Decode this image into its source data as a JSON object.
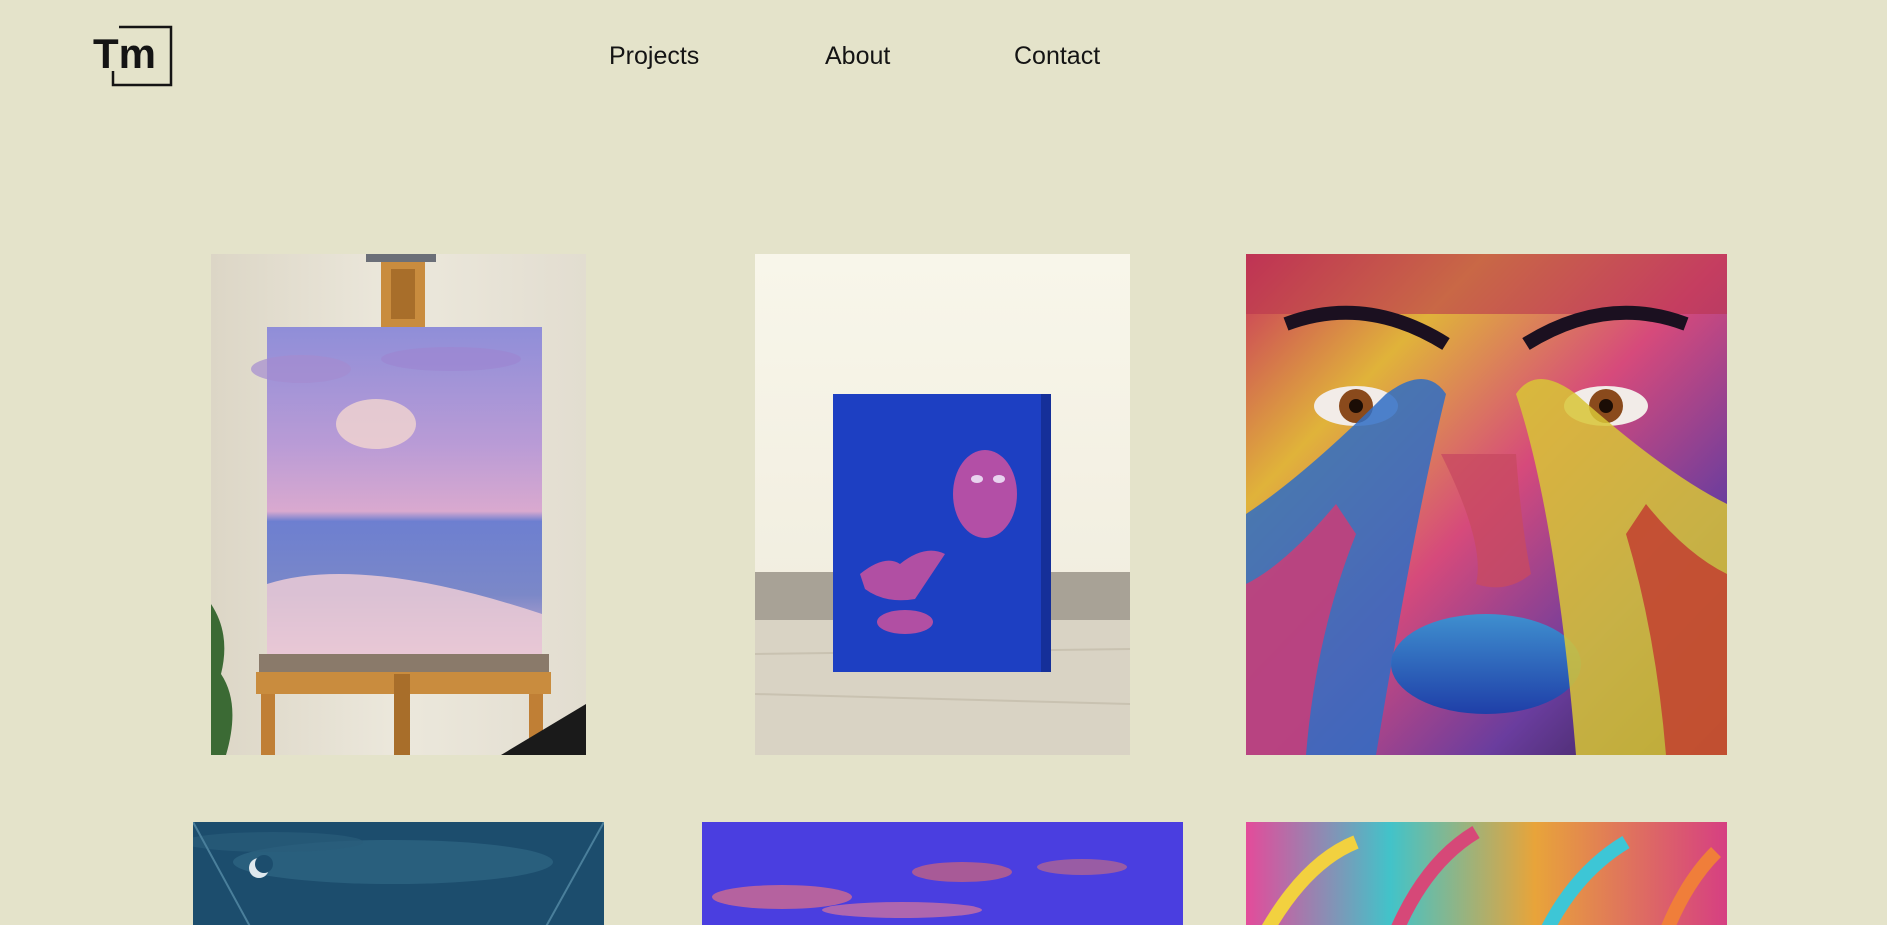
{
  "header": {
    "logo_text": "Tm",
    "nav": {
      "projects_label": "Projects",
      "about_label": "About",
      "contact_label": "Contact"
    }
  },
  "gallery": {
    "tiles": [
      {
        "subject": "easel-sunset-ocean-painting"
      },
      {
        "subject": "blue-canvas-portrait-painting"
      },
      {
        "subject": "colorful-painted-face-photo"
      },
      {
        "subject": "night-sky-moon-painting"
      },
      {
        "subject": "purple-clouds-painting"
      },
      {
        "subject": "painted-hands-photo"
      }
    ]
  },
  "colors": {
    "background": "#e4e3ca",
    "text": "#141414"
  }
}
